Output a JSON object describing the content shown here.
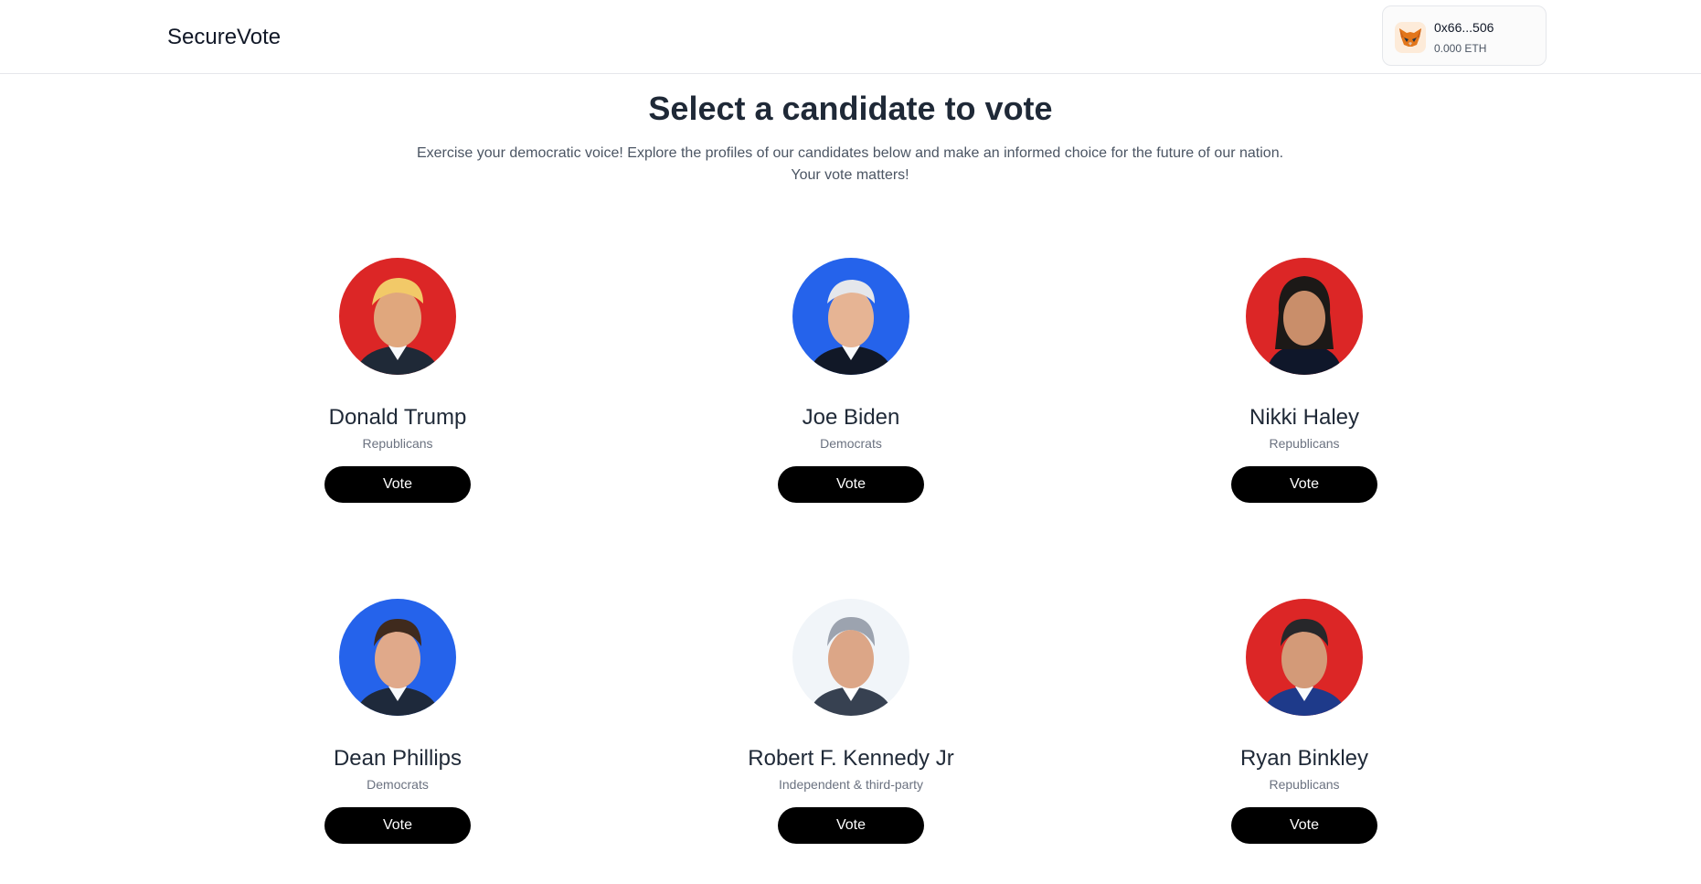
{
  "header": {
    "brand": "SecureVote",
    "wallet": {
      "icon": "metamask-fox-icon",
      "address": "0x66...506",
      "balance": "0.000 ETH"
    }
  },
  "main": {
    "title": "Select a candidate to vote",
    "subtitle_line1": "Exercise your democratic voice! Explore the profiles of our candidates below and make an informed choice for the future of our nation.",
    "subtitle_line2": "Your vote matters!"
  },
  "candidates": [
    {
      "name": "Donald Trump",
      "party": "Republicans",
      "vote_label": "Vote",
      "bg_color": "#dc2626",
      "avatar_icon": "candidate-photo"
    },
    {
      "name": "Joe Biden",
      "party": "Democrats",
      "vote_label": "Vote",
      "bg_color": "#2563eb",
      "avatar_icon": "candidate-photo"
    },
    {
      "name": "Nikki Haley",
      "party": "Republicans",
      "vote_label": "Vote",
      "bg_color": "#dc2626",
      "avatar_icon": "candidate-photo"
    },
    {
      "name": "Dean Phillips",
      "party": "Democrats",
      "vote_label": "Vote",
      "bg_color": "#2563eb",
      "avatar_icon": "candidate-photo"
    },
    {
      "name": "Robert F. Kennedy Jr",
      "party": "Independent & third-party",
      "vote_label": "Vote",
      "bg_color": "#f1f5f9",
      "avatar_icon": "candidate-photo"
    },
    {
      "name": "Ryan Binkley",
      "party": "Republicans",
      "vote_label": "Vote",
      "bg_color": "#dc2626",
      "avatar_icon": "candidate-photo"
    }
  ]
}
